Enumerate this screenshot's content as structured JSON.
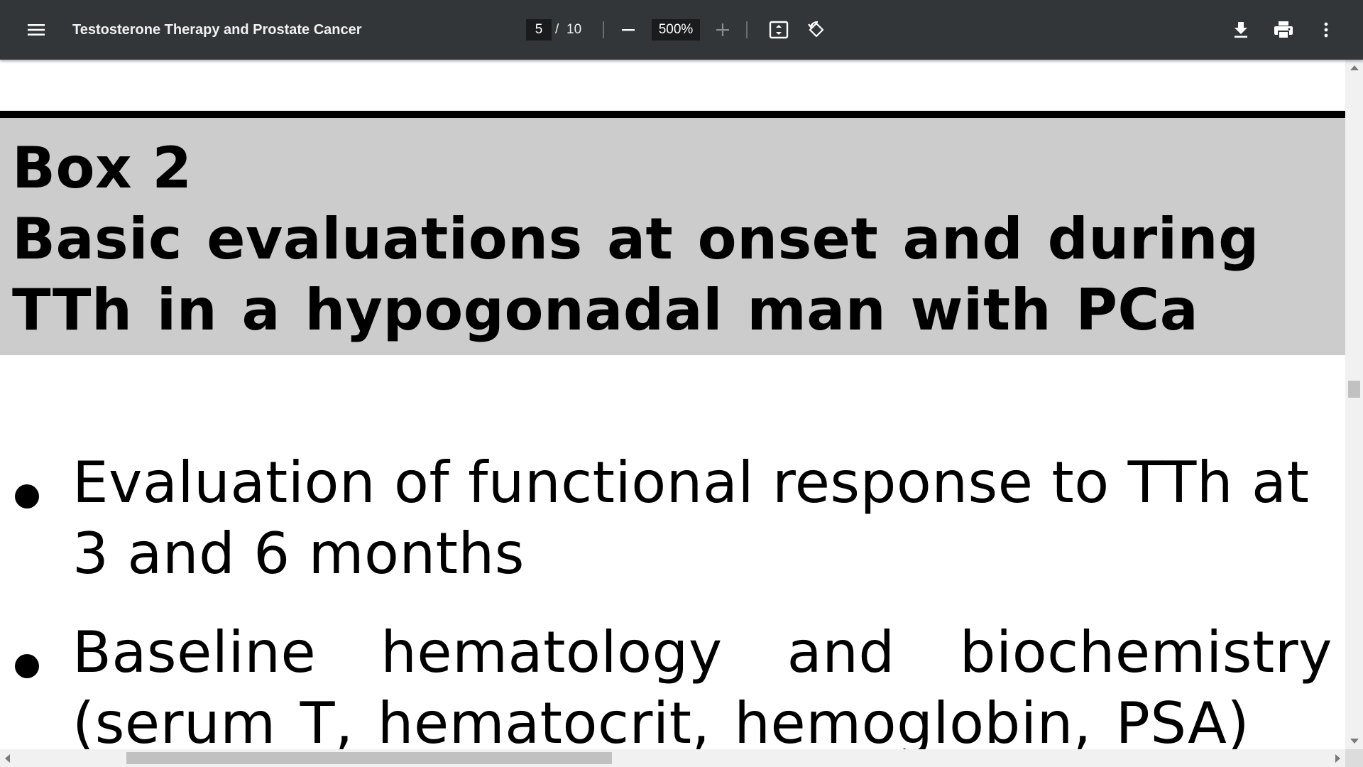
{
  "toolbar": {
    "title": "Testosterone Therapy and Prostate Cancer",
    "current_page": "5",
    "page_separator": "/",
    "total_pages": "10",
    "zoom_level": "500%",
    "icons": {
      "menu": "hamburger-menu-icon",
      "zoom_out": "minus-icon",
      "zoom_in": "plus-icon",
      "fit": "fit-to-page-icon",
      "rotate": "rotate-counterclockwise-icon",
      "download": "download-icon",
      "print": "print-icon",
      "more": "more-vertical-icon"
    },
    "colors": {
      "bar": "#323639",
      "input_bg": "#191b1c",
      "text": "#f1f1f1"
    }
  },
  "document": {
    "box_label": "Box 2",
    "box_title": "Basic evaluations at onset and during TTh in a hypogonadal man with PCa",
    "bullets": [
      "Evaluation of functional response to TTh at 3 and 6 months",
      "Baseline hematology and biochemistry (serum T, hematocrit, hemoglobin, PSA)"
    ],
    "colors": {
      "box_background": "#cccccc",
      "rule": "#000000",
      "text": "#000000"
    }
  }
}
